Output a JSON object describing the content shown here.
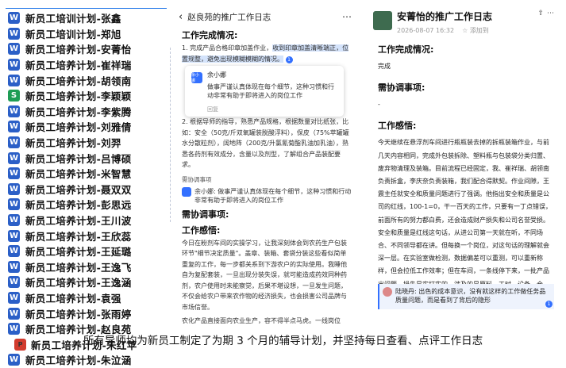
{
  "files": [
    {
      "icon": "W",
      "kind": "w",
      "name": "新员工培训计划-张鑫"
    },
    {
      "icon": "W",
      "kind": "w",
      "name": "新员工培训计划-郑旭"
    },
    {
      "icon": "W",
      "kind": "w",
      "name": "新员工培养计划-安菁怡"
    },
    {
      "icon": "W",
      "kind": "w",
      "name": "新员工培养计划-崔祥瑞"
    },
    {
      "icon": "W",
      "kind": "w",
      "name": "新员工培养计划-胡领南"
    },
    {
      "icon": "S",
      "kind": "s",
      "name": "新员工培养计划-李颖颖"
    },
    {
      "icon": "W",
      "kind": "w",
      "name": "新员工培养计划-李紫腾"
    },
    {
      "icon": "W",
      "kind": "w",
      "name": "新员工培养计划-刘雅倩"
    },
    {
      "icon": "W",
      "kind": "w",
      "name": "新员工培养计划-刘羿"
    },
    {
      "icon": "W",
      "kind": "w",
      "name": "新员工培养计划-吕博硕"
    },
    {
      "icon": "W",
      "kind": "w",
      "name": "新员工培养计划-米智慧"
    },
    {
      "icon": "W",
      "kind": "w",
      "name": "新员工培养计划-聂双双"
    },
    {
      "icon": "W",
      "kind": "w",
      "name": "新员工培养计划-彭思远"
    },
    {
      "icon": "W",
      "kind": "w",
      "name": "新员工培养计划-王川波"
    },
    {
      "icon": "W",
      "kind": "w",
      "name": "新员工培养计划-王欣蕊"
    },
    {
      "icon": "W",
      "kind": "w",
      "name": "新员工培养计划-王延璐"
    },
    {
      "icon": "W",
      "kind": "w",
      "name": "新员工培养计划-王逸飞"
    },
    {
      "icon": "W",
      "kind": "w",
      "name": "新员工培养计划-王逸涵"
    },
    {
      "icon": "W",
      "kind": "w",
      "name": "新员工培养计划-袁强"
    },
    {
      "icon": "W",
      "kind": "w",
      "name": "新员工培养计划-张雨婷"
    },
    {
      "icon": "W",
      "kind": "w",
      "name": "新员工培养计划-赵良苑"
    },
    {
      "icon": "P",
      "kind": "p",
      "name": "新员工培养计划-朱红苹"
    },
    {
      "icon": "W",
      "kind": "w",
      "name": "新员工培养计划-朱泣涵"
    }
  ],
  "mid": {
    "title": "赵良苑的推广工作日志",
    "h_done": "工作完成情况:",
    "p1": "1. 完成产品合格印章加盖作业，",
    "p1_hl": "收到印章加盖清晰端正，位置规整，避免出现模糊模糊的情况。",
    "popup": {
      "name": "余小娜",
      "text": "做事严谨认真体现在每个细节，这种习惯和行动非常有助于即将进入的岗位工作",
      "reply": "回复",
      "avatar": "余小娜"
    },
    "p2": "2. 根据导师的指导，熟悉产品规格，根据数量对比纸张，比如：安全（50克/斤双氧罐装脱酸浮料），保皮（75%苹罐罐水分散粒剂），阔地阵（200克/升氯氰菊酯乳油加乳油），熟悉各药剂有效成分，含量以及剂型，了解组合产品装配要求。",
    "sub": "需协调事项",
    "comment2": "余小娜: 做事严谨认真体现在每个细节，这种习惯和行动非常有助于即将进入的岗位工作",
    "h_coord": "需协调事项:",
    "h_feel": "工作感悟:",
    "p3": "今日在粉剂车间的实操学习，让我深刻体会到农药生产包装环节\"细节决定质量\"。盖章、装箱、套袋分装这些看似简单重复的工作，每一步都关系到下游农户的实际使用。我睡他自为复配套装，一旦出现分装失误，就可能造成药效同种药剂，农户使用时未能察觉，后果不堪设想，一旦发生问题，不仅会给农户带来农作物的经济损失，也会损害公司品牌与市场信誉。",
    "p4": "农化产品直接面向农业生产，容不得半点马虎。一线岗位上，严谨细致不只是工作要求，更是对农户负责，对企业负责。今后工作中，我要时刻保持严谨心态，每一道工序都认真核对，每一件产品都精益求精，用专业严谨的工作态度，把好质量关口，为公司品质和市场负责。"
  },
  "right": {
    "title": "安菁怡的推广工作日志",
    "date": "2026-08-07 16:32",
    "add": "添加到",
    "h_done": "工作完成情况:",
    "done": "完成",
    "h_coord": "需协调事项:",
    "coord": "-",
    "h_feel": "工作感悟:",
    "feel": "今天继续在悬浮剂车间进行瓶瓶装去掉的拆瓶装箱作业，与前几天内容相同，完成外包装拆除、塑料瓶与包装袋分类归置、废弃物清理及装箱。目前流程已经固定，我、崔祥瑞、胡领南负责拆盒，李庆奈负责装箱，我们配合得默契。作业间隙，王震主任就安全和质量问题进行了强调。他指出安全和质量是公司的红线，100-1=0，干一百天的工作，只要有一丁点错误，前面所有的努力都白费，还会造成财产损失和公司名誉受损。安全和质量是红线这句话，从进公司第一天就在听，不同场合、不同领导都在讲。但每换一个岗位，对这句话的理解就会深一层。在实验室做检测，数据偏差可以重测，可以重新称样，但会拉低工作效率；但在车间，一条线停下来，一批产品出问题，损失是实打实的，涉及的是原料、工时、设备、仓储，物流一串环节。",
    "comment": "陆晓丹: 出色的成本意识，没有就这样的工作做任务品质量问题，而是看到了背后的隐形"
  },
  "caption": "所有导师均为新员工制定了为期 3 个月的辅导计划，并坚持每日查看、点评工作日志"
}
